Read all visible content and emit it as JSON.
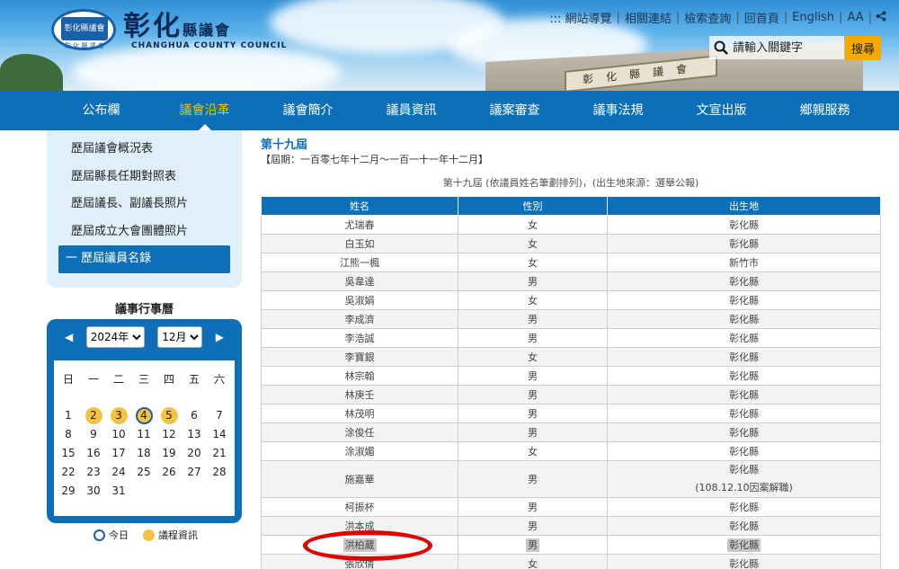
{
  "site": {
    "name": "彰化",
    "name_suffix": "縣議會",
    "name_en": "CHANGHUA COUNTY COUNCIL",
    "logo_inner": "彰化縣議會",
    "logo_sub": "彰 化 縣 議 會",
    "building_sign": "彰化縣議會"
  },
  "toplinks": [
    "::: 網站導覽",
    "相關連結",
    "檢索查詢",
    "回首頁",
    "English",
    "AA"
  ],
  "search": {
    "placeholder": "請輸入關鍵字",
    "button": "搜尋"
  },
  "nav": [
    "公布欄",
    "議會沿革",
    "議會簡介",
    "議員資訊",
    "議案審查",
    "議事法規",
    "文宣出版",
    "鄉親服務"
  ],
  "sidebar": [
    {
      "label": "歷屆議會概況表"
    },
    {
      "label": "歷屆縣長任期對照表"
    },
    {
      "label": "歷屆議長、副議長照片"
    },
    {
      "label": "歷屆成立大會團體照片"
    },
    {
      "label": "一 歷屆議員名錄"
    }
  ],
  "calendar": {
    "title": "議事行事曆",
    "year": "2024年",
    "month": "12月",
    "weekdays": [
      "日",
      "一",
      "二",
      "三",
      "四",
      "五",
      "六"
    ],
    "weeks": [
      [
        "1",
        "2",
        "3",
        "4",
        "5",
        "6",
        "7"
      ],
      [
        "8",
        "9",
        "10",
        "11",
        "12",
        "13",
        "14"
      ],
      [
        "15",
        "16",
        "17",
        "18",
        "19",
        "20",
        "21"
      ],
      [
        "22",
        "23",
        "24",
        "25",
        "26",
        "27",
        "28"
      ],
      [
        "29",
        "30",
        "31",
        "",
        "",
        "",
        ""
      ]
    ],
    "event_days": [
      "2",
      "3",
      "5"
    ],
    "today": "4",
    "legend_today": "今日",
    "legend_event": "議程資訊"
  },
  "main": {
    "term_title": "第十九屆",
    "period": "【屆期：一百零七年十二月～一百一十一年十二月】",
    "caption": "第十九屆 (依議員姓名筆劃排列)，(出生地來源：選舉公報)",
    "columns": [
      "姓名",
      "性別",
      "出生地"
    ],
    "rows": [
      [
        "尤瑞春",
        "女",
        "彰化縣"
      ],
      [
        "白玉如",
        "女",
        "彰化縣"
      ],
      [
        "江熊一楓",
        "女",
        "新竹市"
      ],
      [
        "吳韋達",
        "男",
        "彰化縣"
      ],
      [
        "吳淑娟",
        "女",
        "彰化縣"
      ],
      [
        "李成濟",
        "男",
        "彰化縣"
      ],
      [
        "李浩誠",
        "男",
        "彰化縣"
      ],
      [
        "李寶銀",
        "女",
        "彰化縣"
      ],
      [
        "林宗翰",
        "男",
        "彰化縣"
      ],
      [
        "林庚壬",
        "男",
        "彰化縣"
      ],
      [
        "林茂明",
        "男",
        "彰化縣"
      ],
      [
        "涂俊任",
        "男",
        "彰化縣"
      ],
      [
        "涂淑媚",
        "女",
        "彰化縣"
      ],
      [
        "施嘉華",
        "男",
        "彰化縣",
        "(108.12.10因案解職)"
      ],
      [
        "柯振杯",
        "男",
        "彰化縣"
      ],
      [
        "洪本成",
        "男",
        "彰化縣"
      ],
      [
        "洪柏葳",
        "男",
        "彰化縣"
      ],
      [
        "張欣倩",
        "女",
        "彰化縣"
      ]
    ],
    "highlighted_row": 16
  }
}
